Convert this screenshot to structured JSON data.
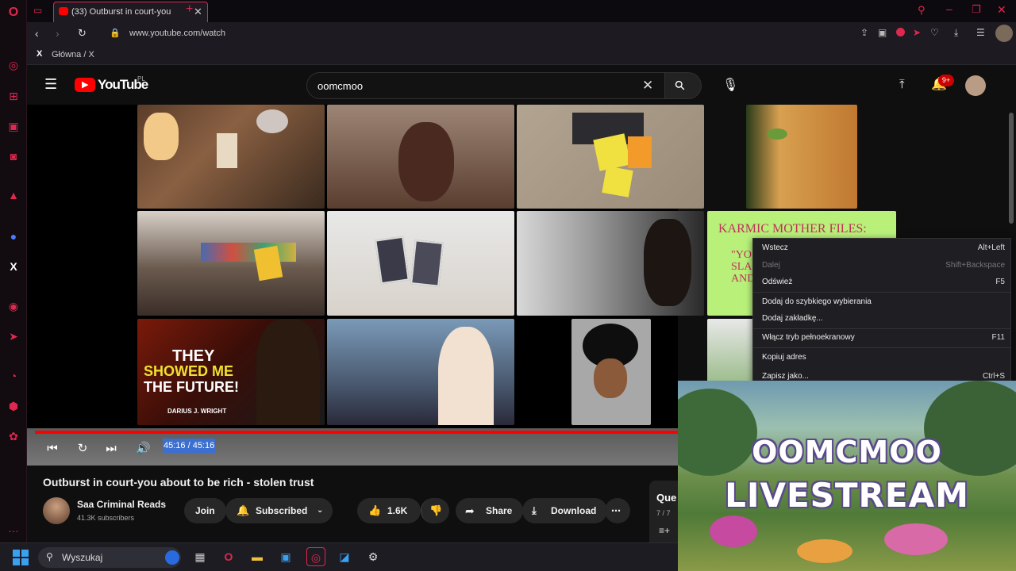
{
  "browser": {
    "tab_title": "(33) Outburst in court-you",
    "url": "www.youtube.com/watch",
    "bookmark_label": "Główna / X",
    "accent_color": "#e0284f"
  },
  "youtube": {
    "logo_text": "YouTube",
    "region": "PL",
    "search_value": "oomcmoo",
    "notification_badge": "9+"
  },
  "video": {
    "time_display": "45:16 / 45:16",
    "thumbnail_texts": {
      "they_showed": "THEY",
      "showed_me": "SHOWED ME",
      "the_future": "THE FUTURE!",
      "author": "DARIUS J. WRIGHT",
      "karmic": "KARMIC MOTHER FILES:",
      "karmic_fragment": "\"YO\nSLA\nAND"
    }
  },
  "details": {
    "title": "Outburst in court-you about to be rich - stolen trust",
    "channel_name": "Saa Criminal Reads",
    "subscribers": "41.3K subscribers",
    "join_label": "Join",
    "subscribed_label": "Subscribed",
    "likes": "1.6K",
    "share_label": "Share",
    "download_label": "Download",
    "queue_label": "Que",
    "queue_count": "7 / 7"
  },
  "context_menu": {
    "items": [
      {
        "label": "Wstecz",
        "shortcut": "Alt+Left"
      },
      {
        "label": "Dalej",
        "shortcut": "Shift+Backspace"
      },
      {
        "label": "Odśwież",
        "shortcut": "F5"
      },
      {
        "label": "Dodaj do szybkiego wybierania",
        "shortcut": ""
      },
      {
        "label": "Dodaj zakładkę...",
        "shortcut": ""
      },
      {
        "label": "Włącz tryb pełnoekranowy",
        "shortcut": "F11"
      },
      {
        "label": "Kopiuj adres",
        "shortcut": ""
      },
      {
        "label": "Zapisz jako...",
        "shortcut": "Ctrl+S"
      }
    ]
  },
  "livestream": {
    "line1": "OOMCMOO",
    "line2": "LIVESTREAM"
  },
  "taskbar": {
    "search_label": "Wyszukaj"
  }
}
